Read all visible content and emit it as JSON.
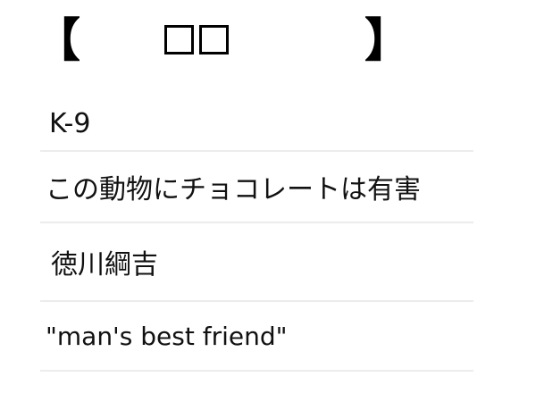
{
  "answer": {
    "bracket_open": "【",
    "bracket_close": "】",
    "blank_count": 2
  },
  "hints": [
    "K-9",
    "この動物にチョコレートは有害",
    "徳川綱吉",
    "\"man's best friend\""
  ]
}
